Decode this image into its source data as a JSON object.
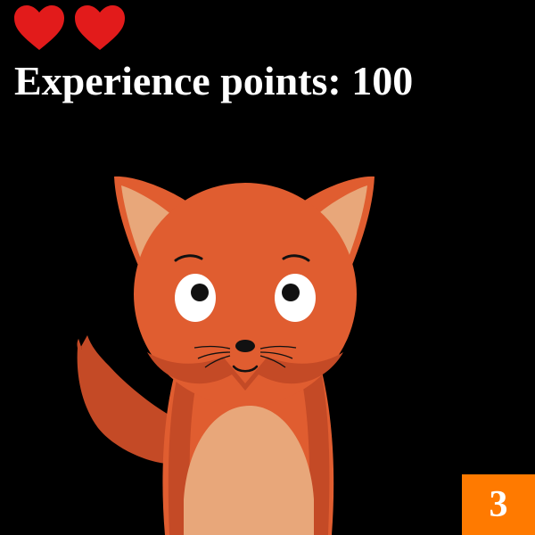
{
  "hud": {
    "lives": 2,
    "heart_icon": "heart-icon",
    "heart_color": "#e21b1b",
    "xp_label": "Experience points:",
    "xp_value": "100"
  },
  "level_badge": {
    "value": "3",
    "color": "#ff7a00"
  },
  "character": {
    "icon": "fox-character",
    "colors": {
      "fur": "#e05d30",
      "fur_dark": "#c44a26",
      "ear_inner": "#e8a77a",
      "belly": "#e8a77a",
      "eye_white": "#ffffff",
      "pupil": "#111111"
    }
  }
}
